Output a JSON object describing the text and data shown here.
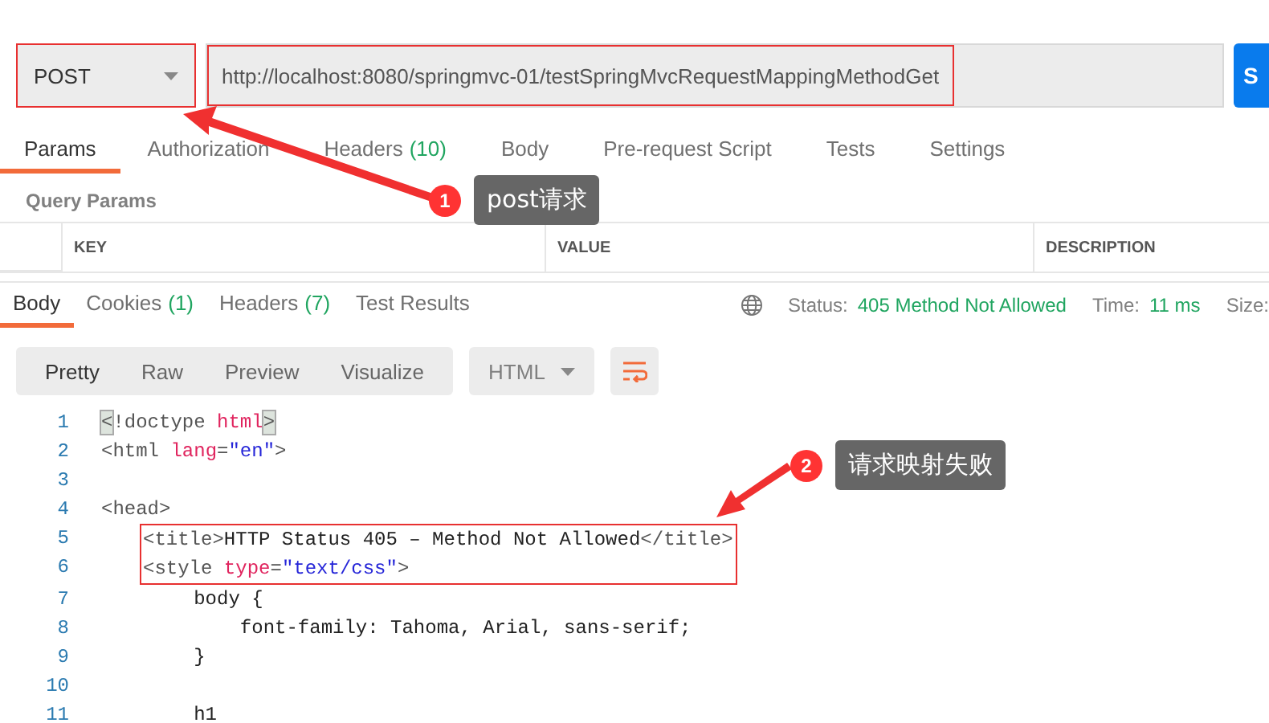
{
  "request": {
    "method": "POST",
    "method_highlighted": true,
    "url": "http://localhost:8080/springmvc-01/testSpringMvcRequestMappingMethodGet",
    "url_highlighted": true,
    "send_label": "S"
  },
  "request_tabs": [
    {
      "label": "Params",
      "selected": true
    },
    {
      "label": "Authorization",
      "selected": false
    },
    {
      "label": "Headers",
      "count": "(10)",
      "selected": false
    },
    {
      "label": "Body",
      "selected": false
    },
    {
      "label": "Pre-request Script",
      "selected": false
    },
    {
      "label": "Tests",
      "selected": false
    },
    {
      "label": "Settings",
      "selected": false
    }
  ],
  "query_params": {
    "title": "Query Params",
    "columns": [
      "KEY",
      "VALUE",
      "DESCRIPTION"
    ]
  },
  "response_tabs": [
    {
      "label": "Body",
      "selected": true
    },
    {
      "label": "Cookies",
      "count": "(1)",
      "selected": false
    },
    {
      "label": "Headers",
      "count": "(7)",
      "selected": false
    },
    {
      "label": "Test Results",
      "selected": false
    }
  ],
  "response_status": {
    "status_label": "Status:",
    "status": "405 Method Not Allowed",
    "time_label": "Time:",
    "time": "11 ms",
    "size_label": "Size:"
  },
  "view_modes": [
    {
      "label": "Pretty",
      "selected": true
    },
    {
      "label": "Raw",
      "selected": false
    },
    {
      "label": "Preview",
      "selected": false
    },
    {
      "label": "Visualize",
      "selected": false
    }
  ],
  "format": "HTML",
  "code_lines": [
    {
      "number": "1",
      "highlighted": false,
      "tokens": [
        {
          "kind": "bracket",
          "text": "<"
        },
        {
          "kind": "tag",
          "text": "!doctype "
        },
        {
          "kind": "attr",
          "text": "html"
        },
        {
          "kind": "bracket",
          "text": ">"
        }
      ]
    },
    {
      "number": "2",
      "highlighted": false,
      "tokens": [
        {
          "kind": "tag",
          "text": "<html "
        },
        {
          "kind": "attr",
          "text": "lang"
        },
        {
          "kind": "tag",
          "text": "="
        },
        {
          "kind": "string",
          "text": "\"en\""
        },
        {
          "kind": "tag",
          "text": ">"
        }
      ]
    },
    {
      "number": "3",
      "highlighted": false
    },
    {
      "number": "4",
      "highlighted": false,
      "tokens": [
        {
          "kind": "tag",
          "text": "<head>"
        }
      ]
    },
    {
      "number": "5",
      "highlighted": true,
      "tokens": [
        {
          "kind": "tag",
          "text": "<title>"
        },
        {
          "kind": "text",
          "text": "HTTP Status 405 – Method Not Allowed"
        },
        {
          "kind": "tag",
          "text": "</title>"
        }
      ]
    },
    {
      "number": "6",
      "highlighted": true,
      "tokens": [
        {
          "kind": "tag",
          "text": "<style "
        },
        {
          "kind": "attr",
          "text": "type"
        },
        {
          "kind": "tag",
          "text": "="
        },
        {
          "kind": "string",
          "text": "\"text/css\""
        },
        {
          "kind": "tag",
          "text": ">"
        }
      ]
    },
    {
      "number": "7",
      "highlighted": false,
      "tokens": [
        {
          "kind": "text",
          "text": "        body {"
        }
      ]
    },
    {
      "number": "8",
      "highlighted": false,
      "tokens": [
        {
          "kind": "text",
          "text": "            font-family: Tahoma, Arial, sans-serif;"
        }
      ]
    },
    {
      "number": "9",
      "highlighted": false,
      "tokens": [
        {
          "kind": "text",
          "text": "        }"
        }
      ]
    },
    {
      "number": "10",
      "highlighted": false
    },
    {
      "number": "11",
      "highlighted": false,
      "tokens": [
        {
          "kind": "text",
          "text": "        h1"
        }
      ]
    }
  ],
  "annotations": [
    {
      "number": "1",
      "text": "post请求"
    },
    {
      "number": "2",
      "text": "请求映射失败"
    }
  ]
}
